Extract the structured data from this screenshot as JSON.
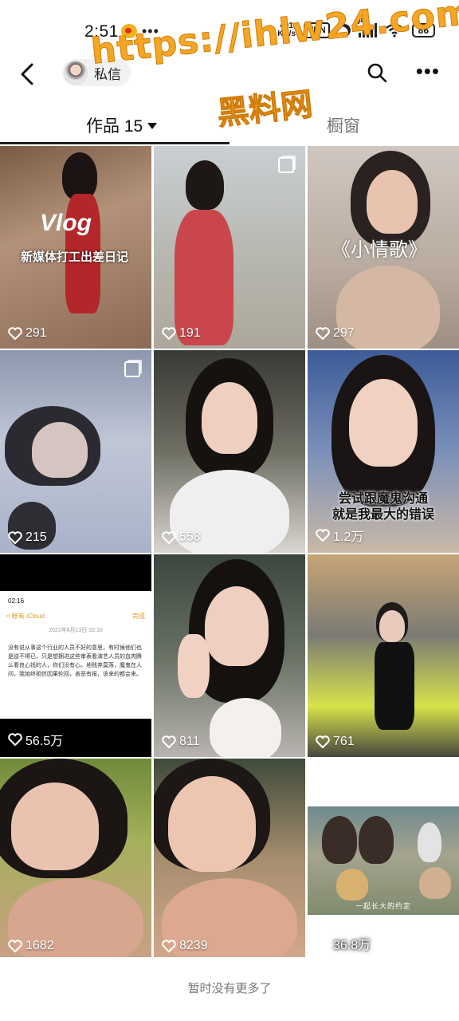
{
  "status_bar": {
    "time": "2:51",
    "more": "•••",
    "net_speed_value": "401",
    "net_speed_unit": "KB/s",
    "vpn": "VPN",
    "signal_label": "HD",
    "battery": "86"
  },
  "header": {
    "title": "私信",
    "more": "•••"
  },
  "watermark": {
    "url": "https://ihlw24.com",
    "cn": "黑料网"
  },
  "tabs": {
    "works": "作品 15",
    "window": "橱窗"
  },
  "posts": [
    {
      "likes": "291",
      "caption_a": "Vlog",
      "caption_b": "新媒体打工出差日记"
    },
    {
      "likes": "191"
    },
    {
      "likes": "297",
      "caption_a": "《小情歌》"
    },
    {
      "likes": "215"
    },
    {
      "likes": "558"
    },
    {
      "likes": "1.2万",
      "caption_a": "尝试跟魔鬼沟通",
      "caption_b": "就是我最大的错误"
    },
    {
      "likes": "56.5万",
      "doc_time": "02:16",
      "doc_back": "< 帐有 iCloud",
      "doc_done": "完成",
      "doc_date": "2022年8月13日 02:16",
      "doc_text": "没有说从事这个行业的人员不好的意思，有时候他们也是迫不得已，只是想拥进这些审表看演艺人员的血肉腾么看良心钱的人，你们没有心。地贱弃莫落，魔鬼在人间，我始终相信因果轮回，善恶有报，该来的都会来。"
    },
    {
      "likes": "811"
    },
    {
      "likes": "761"
    },
    {
      "likes": "1682"
    },
    {
      "likes": "8239"
    },
    {
      "likes": "36.8万",
      "caption_a": "一起长大的约定"
    }
  ],
  "footer": {
    "text": "暂时没有更多了"
  }
}
